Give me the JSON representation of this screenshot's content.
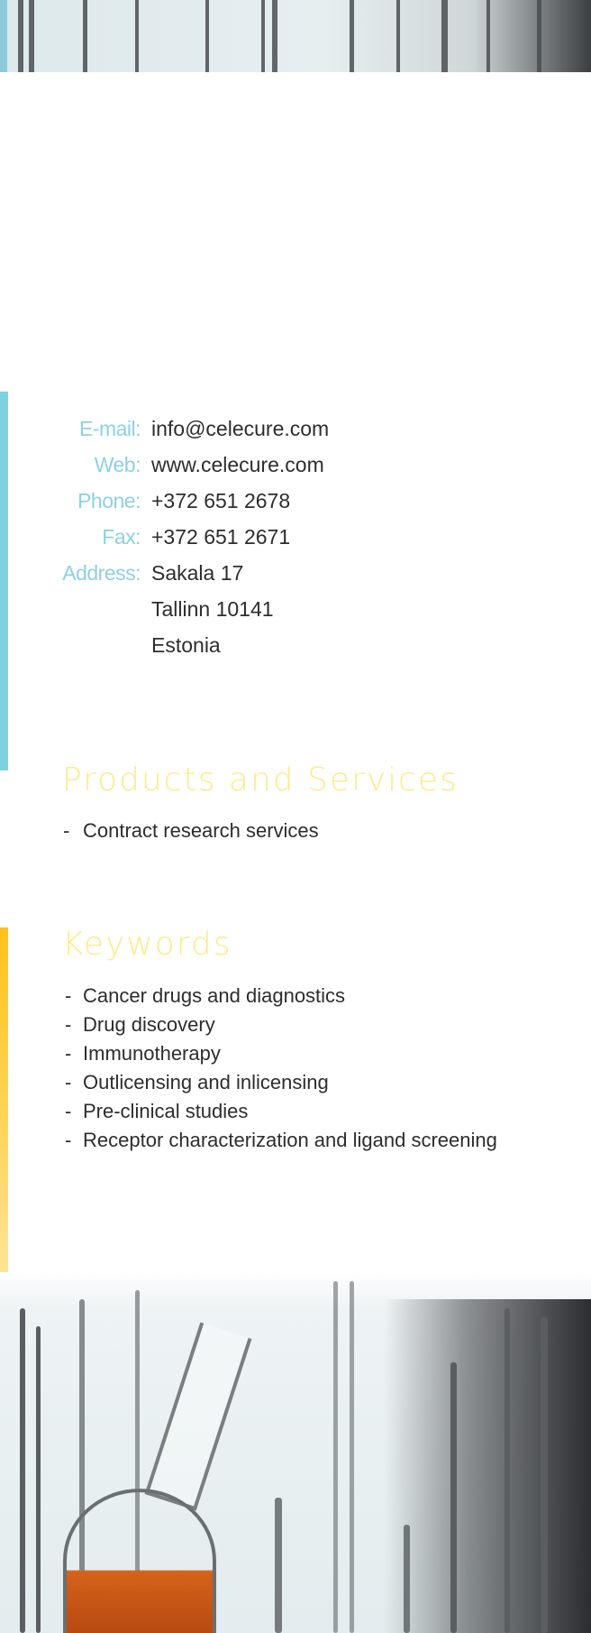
{
  "contact": [
    {
      "label": "E-mail:",
      "value": "info@celecure.com"
    },
    {
      "label": "Web:",
      "value": "www.celecure.com"
    },
    {
      "label": "Phone:",
      "value": "+372 651 2678"
    },
    {
      "label": "Fax:",
      "value": "+372 651 2671"
    },
    {
      "label": "Address:",
      "value": "Sakala 17"
    },
    {
      "label": "",
      "value": "Tallinn 10141"
    },
    {
      "label": "",
      "value": "Estonia"
    }
  ],
  "products": {
    "title": "Products and Services",
    "items": [
      "Contract research services"
    ]
  },
  "keywords": {
    "title": "Keywords",
    "items": [
      "Cancer drugs and diagnostics",
      "Drug discovery",
      "Immunotherapy",
      "Outlicensing and inlicensing",
      "Pre-clinical studies",
      "Receptor characterization and ligand screening"
    ]
  },
  "colors": {
    "label_cyan": "#8fd0e2",
    "accent_cyan_bar": "#7ed2e0",
    "accent_yellow_bar": "#ffc21a",
    "heading_yellow": "#ffe98a",
    "text": "#2d2d2d"
  }
}
